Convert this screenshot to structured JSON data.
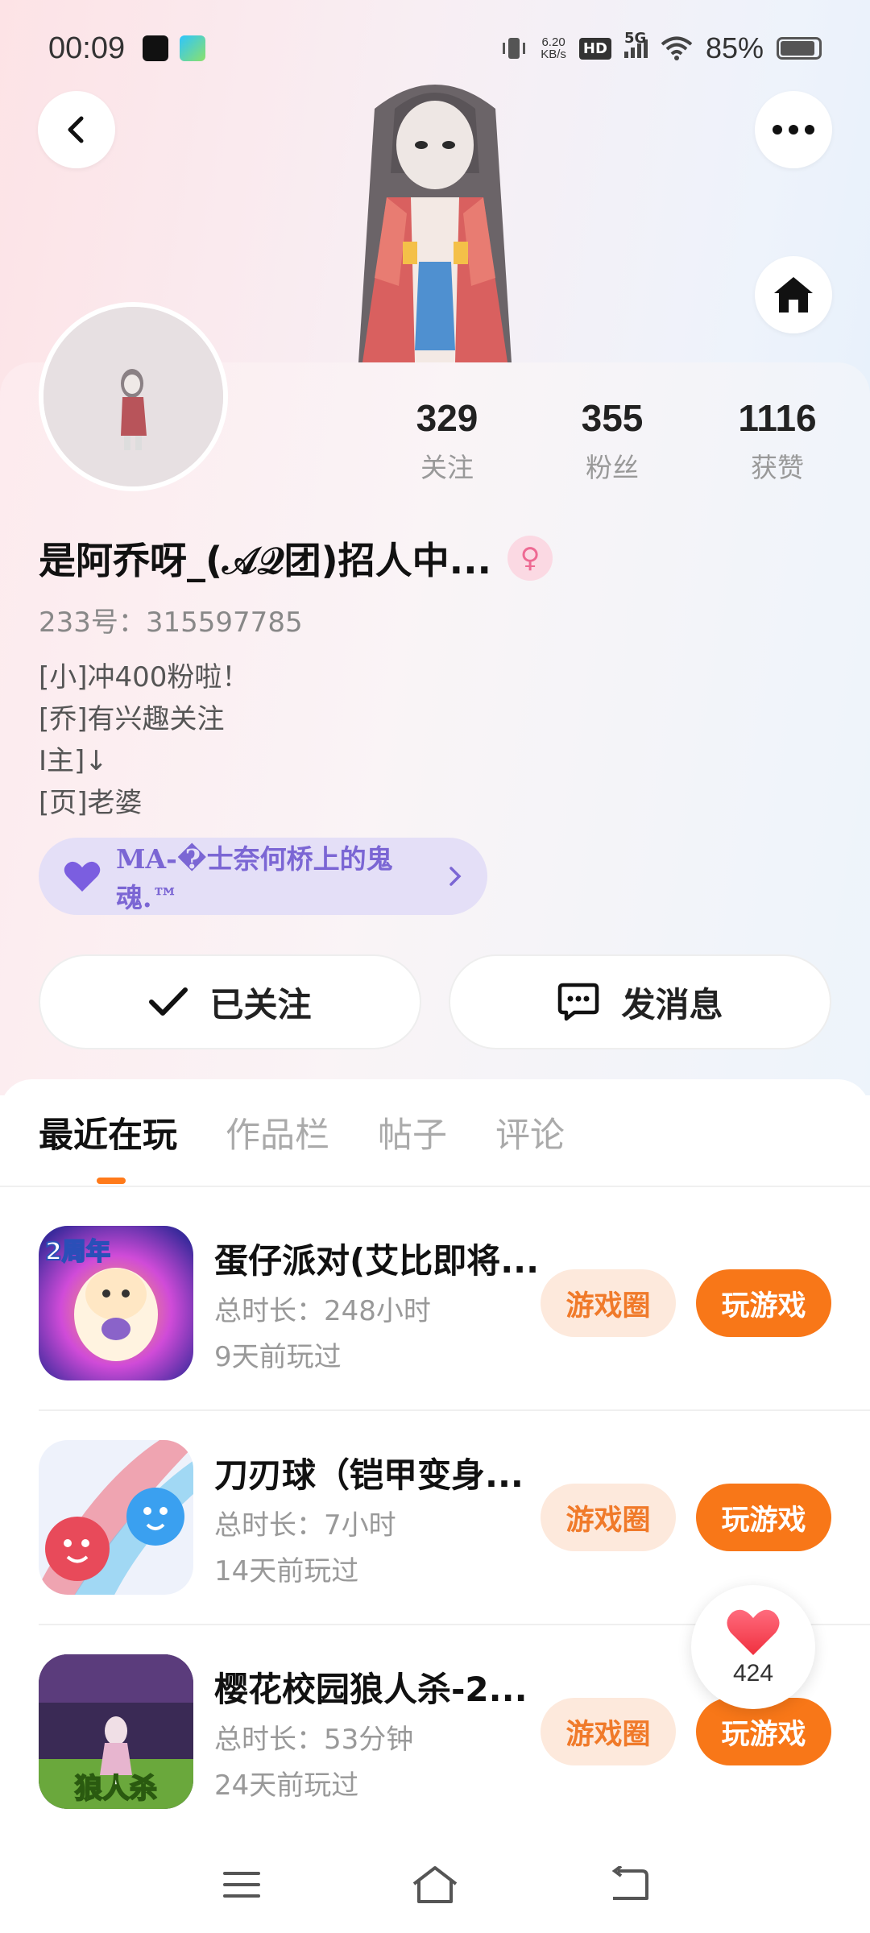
{
  "status_bar": {
    "time": "00:09",
    "net_speed_value": "6.20",
    "net_speed_unit": "KB/s",
    "hd": "HD",
    "network": "5G",
    "battery": "85%"
  },
  "profile": {
    "stats": [
      {
        "value": "329",
        "label": "关注"
      },
      {
        "value": "355",
        "label": "粉丝"
      },
      {
        "value": "1116",
        "label": "获赞"
      }
    ],
    "nickname": "是阿乔呀_(𝒜𝒬团)招人中...",
    "gender_symbol": "♀",
    "uid": "233号：315597785",
    "bio": [
      "[小]冲400粉啦！",
      "[乔]有兴趣关注",
      "I主]↓",
      "[页]老婆"
    ],
    "club": "MA-�士奈何桥上的鬼魂.™",
    "follow_label": "已关注",
    "message_label": "发消息"
  },
  "tabs": [
    {
      "label": "最近在玩",
      "active": true
    },
    {
      "label": "作品栏",
      "active": false
    },
    {
      "label": "帖子",
      "active": false
    },
    {
      "label": "评论",
      "active": false
    }
  ],
  "games": [
    {
      "title": "蛋仔派对(艾比即将...",
      "duration": "总时长：248小时",
      "last_played": "9天前玩过",
      "circle_label": "游戏圈",
      "play_label": "玩游戏",
      "badge": "2周年"
    },
    {
      "title": "刀刃球（铠甲变身...",
      "duration": "总时长：7小时",
      "last_played": "14天前玩过",
      "circle_label": "游戏圈",
      "play_label": "玩游戏"
    },
    {
      "title": "樱花校园狼人杀-2...",
      "duration": "总时长：53分钟",
      "last_played": "24天前玩过",
      "circle_label": "游戏圈",
      "play_label": "玩游戏",
      "badge": "狼人杀"
    }
  ],
  "like": {
    "count": "424"
  },
  "colors": {
    "accent": "#f87718",
    "accent_soft": "#fde9dc",
    "club_bg": "#e4dff7",
    "club_text": "#7b66d4"
  }
}
